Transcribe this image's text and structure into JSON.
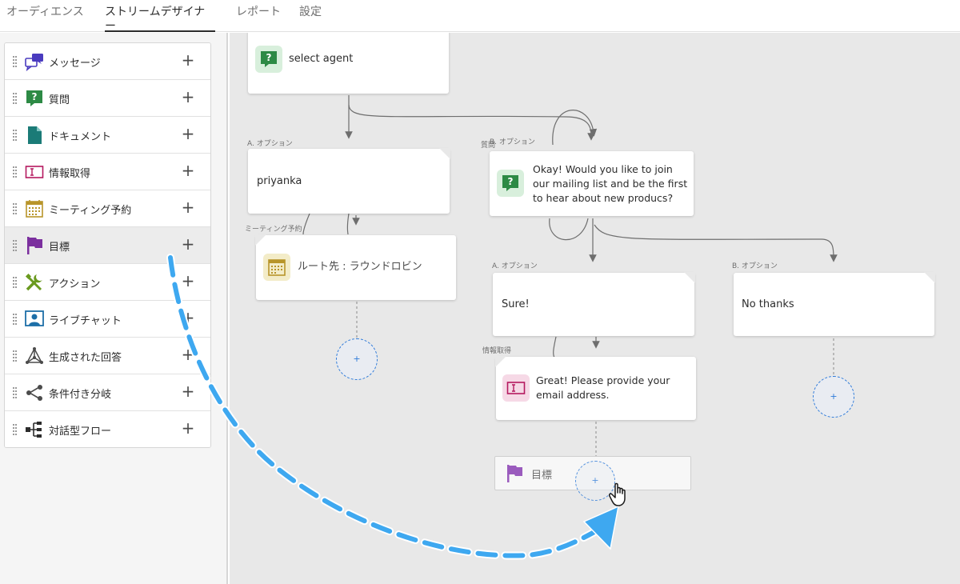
{
  "tabs": [
    {
      "label": "オーディエンス"
    },
    {
      "label": "ストリームデザイナー"
    },
    {
      "label": "レポート"
    },
    {
      "label": "設定"
    }
  ],
  "sidebar": {
    "items": [
      {
        "label": "メッセージ",
        "icon": "chat-bubbles-icon"
      },
      {
        "label": "質問",
        "icon": "question-icon"
      },
      {
        "label": "ドキュメント",
        "icon": "document-icon"
      },
      {
        "label": "情報取得",
        "icon": "text-input-icon"
      },
      {
        "label": "ミーティング予約",
        "icon": "calendar-icon"
      },
      {
        "label": "目標",
        "icon": "flag-icon"
      },
      {
        "label": "アクション",
        "icon": "tools-icon"
      },
      {
        "label": "ライブチャット",
        "icon": "live-chat-icon"
      },
      {
        "label": "生成された回答",
        "icon": "network-icon"
      },
      {
        "label": "条件付き分岐",
        "icon": "branch-icon"
      },
      {
        "label": "対話型フロー",
        "icon": "flow-icon"
      }
    ],
    "add_symbol": "+"
  },
  "canvas": {
    "nodes": {
      "select_agent": {
        "text": "select agent"
      },
      "option_a_left": {
        "label": "A. オプション",
        "text": "priyanka"
      },
      "meeting": {
        "label": "ミーティング予約",
        "text": "ルート先 : ラウンドロビン"
      },
      "question": {
        "label_type": "質問",
        "label_option": "B. オプション",
        "text": "Okay! Would you like to join our mailing list and be the first to hear about new producs?"
      },
      "option_a_right": {
        "label": "A. オプション",
        "text": "Sure!"
      },
      "option_b_right": {
        "label": "B. オプション",
        "text": "No thanks"
      },
      "info_capture": {
        "label": "情報取得",
        "text": "Great! Please provide your email address."
      },
      "goal_drop": {
        "text": "目標"
      }
    },
    "add_symbol": "+"
  },
  "colors": {
    "question_green": "#2d8a45",
    "info_pink": "#b5195f",
    "calendar_gold": "#b8952a",
    "flag_purple": "#7b2f9e",
    "drag_arrow_blue": "#3ea8f0",
    "add_circle_blue": "#2f7bd9"
  }
}
